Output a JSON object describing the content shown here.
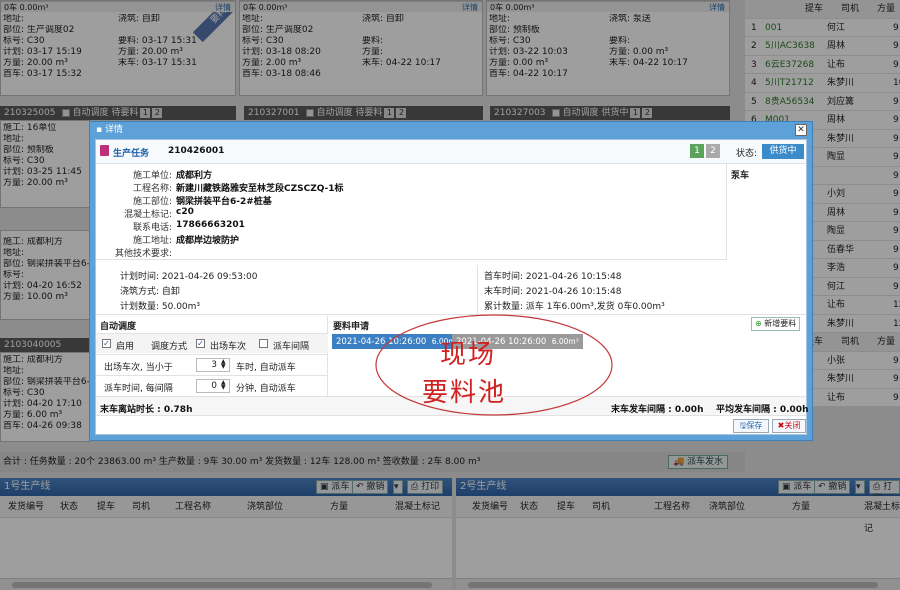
{
  "bg_cards": [
    {
      "lines": [
        "施工: 16单位",
        "地址:",
        "部位: 生产调度02",
        "标号: C30",
        "计划: 03-17 15:19",
        "方量: 20.00 m³",
        "首车: 03-17 15:32"
      ],
      "mid": [
        "浇筑: 自卸",
        "",
        "要料: 03-17 15:31",
        "方量: 20.00 m³",
        "末车: 03-17 15:31"
      ],
      "foot": "0车  0.00m³",
      "more": "详情",
      "ribbon": "要料"
    },
    {
      "lines": [
        "施工: 318XZ",
        "地址:",
        "部位: 生产调度02",
        "标号: C30",
        "计划: 03-18 08:20",
        "方量: 2.00 m³",
        "首车: 03-18 08:46"
      ],
      "mid": [
        "浇筑: 自卸",
        "",
        "要料:",
        "方量:",
        "末车: 04-22 10:17"
      ],
      "foot": "0车  0.00m³",
      "more": "详情"
    },
    {
      "lines": [
        "施工: 16单位",
        "地址:",
        "部位: 预制板",
        "标号: C30",
        "计划: 03-22 10:03",
        "方量: 0.00 m³",
        "首车: 04-22 10:17"
      ],
      "mid": [
        "浇筑: 泵送",
        "",
        "要料:",
        "方量: 0.00 m³",
        "末车: 04-22 10:17"
      ],
      "foot": "0车  0.00m³",
      "more": "详情"
    }
  ],
  "row2_headers": [
    {
      "code": "210325005",
      "auto": "自动调度",
      "state": "待要料"
    },
    {
      "code": "210327001",
      "auto": "自动调度",
      "state": "待要料"
    },
    {
      "code": "210327003",
      "auto": "自动调度",
      "state": "供货中"
    }
  ],
  "left_cards": [
    {
      "lines": [
        "施工: 16单位",
        "地址:",
        "部位: 预制板",
        "标号: C30",
        "计划: 03-25 11:45",
        "方量: 20.00 m³"
      ]
    },
    {
      "lines": [
        "施工: 成都利方",
        "地址:",
        "部位: 钢梁拼装平台6-2",
        "标号:",
        "计划: 04-20 16:52",
        "方量: 10.00 m³"
      ]
    },
    {
      "code": "2103040005",
      "lines": [
        "施工: 成都利方",
        "地址:",
        "部位: 钢梁拼装平台6-2",
        "标号: C30",
        "计划: 04-20 17:10",
        "方量: 6.00 m³",
        "首车: 04-26 09:38"
      ]
    }
  ],
  "right_table": {
    "headers": [
      "提车",
      "司机",
      "方量"
    ],
    "rows": [
      [
        "1",
        "001",
        "何江",
        "9"
      ],
      [
        "2",
        "5川AC3638",
        "周林",
        "9"
      ],
      [
        "3",
        "6云E37268",
        "让布",
        "9"
      ],
      [
        "4",
        "5川T21712",
        "朱梦川",
        "10"
      ],
      [
        "5",
        "8贵A56534",
        "刘应篝",
        "9"
      ],
      [
        "6",
        "M001",
        "周林",
        "9"
      ],
      [
        "",
        "",
        "朱梦川",
        "9"
      ],
      [
        "",
        "",
        "陶显",
        "9"
      ],
      [
        "",
        "",
        "",
        "9"
      ],
      [
        "",
        "",
        "小刘",
        "9"
      ],
      [
        "",
        "",
        "周林",
        "9"
      ],
      [
        "",
        "",
        "陶显",
        "9"
      ],
      [
        "",
        "",
        "伍春华",
        "9"
      ],
      [
        "",
        "",
        "李浩",
        "9"
      ],
      [
        "",
        "",
        "何江",
        "9"
      ],
      [
        "",
        "",
        "让布",
        "12"
      ],
      [
        "",
        "",
        "朱梦川",
        "12"
      ]
    ],
    "headers2": [
      "提车",
      "司机",
      "方量"
    ],
    "rows2": [
      [
        "",
        "",
        "小张",
        "9"
      ],
      [
        "",
        "",
        "朱梦川",
        "9"
      ],
      [
        "",
        "",
        "让布",
        "9"
      ]
    ],
    "top_label": "涉排箱车"
  },
  "modal": {
    "title": "详情",
    "task_label": "生产任务",
    "task_no": "210426001",
    "pages": [
      "1",
      "2"
    ],
    "status_label": "状态:",
    "status_value": "供货中",
    "pump_label": "泵车",
    "info": [
      {
        "label": "施工单位:",
        "value": "成都利方"
      },
      {
        "label": "工程名称:",
        "value": "新建川藏铁路雅安至林芝段CZSCZQ-1标"
      },
      {
        "label": "施工部位:",
        "value": "钢梁拼装平台6-2#桩基"
      },
      {
        "label": "混凝土标记:",
        "value": "c20"
      },
      {
        "label": "联系电话:",
        "value": "17866663201"
      },
      {
        "label": "施工地址:",
        "value": "成都岸边坡防护"
      },
      {
        "label": "其他技术要求:",
        "value": ""
      }
    ],
    "plan_time": "计划时间:  2021-04-26 09:53:00",
    "pour_mode": "浇筑方式:  自卸",
    "plan_qty": "计划数量:  50.00m³",
    "first_car": "首车时间:  2021-04-26 10:15:48",
    "last_car": "末车时间:  2021-04-26 10:15:48",
    "total_qty": "累计数量:  派车 1车6.00m³,发货 0车0.00m³",
    "auto_title": "自动调度",
    "enable": "启用",
    "mode_label": "调度方式",
    "opt1": "出场车次",
    "opt2": "派车间隔",
    "r1_label": "出场车次, 当小于",
    "r1_val": "3",
    "r1_unit": "车时, 自动派车",
    "r2_label": "派车时间, 每间隔",
    "r2_val": "0",
    "r2_unit": "分钟, 自动派车",
    "req_title": "要料申请",
    "req_items": [
      {
        "time": "2021-04-26 10:26:00",
        "qty": "6.00m³"
      },
      {
        "time": "2021-04-26 10:26:00",
        "qty": "6.00m³"
      }
    ],
    "add_btn": "新增要料",
    "leave_label": "末车离站时长 : 0.78h",
    "last_interval": "末车发车间隔 : 0.00h",
    "avg_interval": "平均发车间隔 : 0.00h",
    "save": "保存",
    "close": "关闭",
    "hand_line1": "现场",
    "hand_line2": "要料池"
  },
  "status_bar": "合计 : 任务数量 : 20个  23863.00 m³   生产数量 : 9车 30.00 m³   发货数量 : 12车 128.00 m³   签收数量 : 2车 8.00 m³",
  "dispatch_water": "派车发水",
  "lines": [
    {
      "title": "1号生产线",
      "dispatch": "派车",
      "cancel": "撤销",
      "print": "打印"
    },
    {
      "title": "2号生产线",
      "dispatch": "派车",
      "cancel": "撤销",
      "print": "打印"
    }
  ],
  "line_cols": [
    "发货编号",
    "状态",
    "提车",
    "司机",
    "工程名称",
    "浇筑部位",
    "方量",
    "混凝土标记"
  ]
}
